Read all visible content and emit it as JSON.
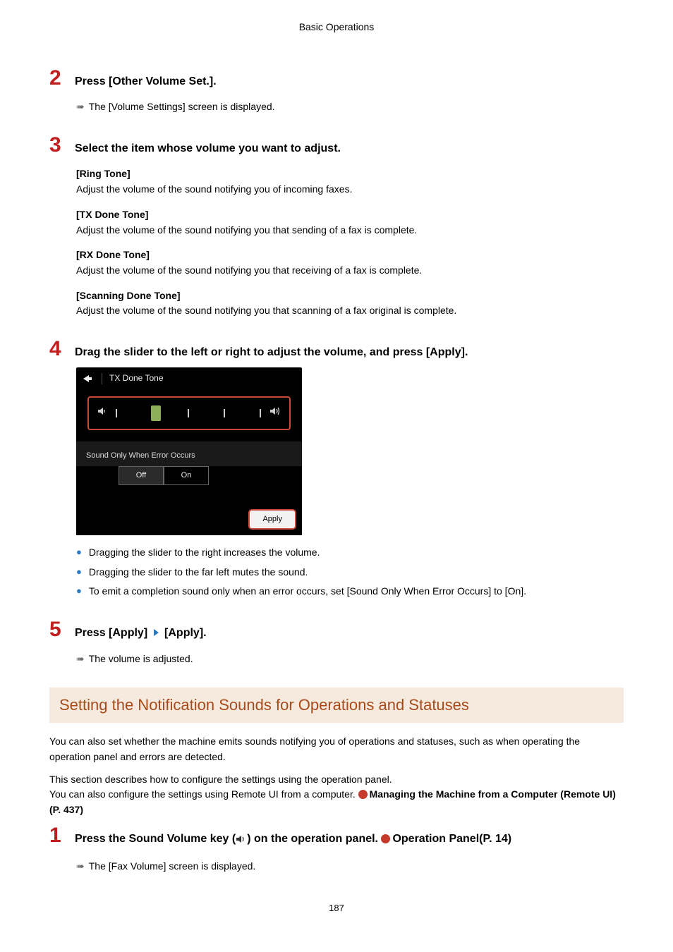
{
  "header": {
    "title": "Basic Operations"
  },
  "page_number": "187",
  "step2": {
    "num": "2",
    "title": "Press [Other Volume Set.].",
    "result": "The [Volume Settings] screen is displayed."
  },
  "step3": {
    "num": "3",
    "title": "Select the item whose volume you want to adjust.",
    "items": [
      {
        "name": "[Ring Tone]",
        "desc": "Adjust the volume of the sound notifying you of incoming faxes."
      },
      {
        "name": "[TX Done Tone]",
        "desc": "Adjust the volume of the sound notifying you that sending of a fax is complete."
      },
      {
        "name": "[RX Done Tone]",
        "desc": "Adjust the volume of the sound notifying you that receiving of a fax is complete."
      },
      {
        "name": "[Scanning Done Tone]",
        "desc": "Adjust the volume of the sound notifying you that scanning of a fax original is complete."
      }
    ]
  },
  "step4": {
    "num": "4",
    "title": "Drag the slider to the left or right to adjust the volume, and press [Apply].",
    "shot": {
      "title": "TX Done Tone",
      "section_label": "Sound Only When Error Occurs",
      "off": "Off",
      "on": "On",
      "apply": "Apply"
    },
    "bullets": [
      "Dragging the slider to the right increases the volume.",
      "Dragging the slider to the far left mutes the sound.",
      "To emit a completion sound only when an error occurs, set [Sound Only When Error Occurs] to [On]."
    ]
  },
  "step5": {
    "num": "5",
    "title_a": "Press [Apply]",
    "title_b": "[Apply].",
    "result": "The volume is adjusted."
  },
  "section": {
    "title": "Setting the Notification Sounds for Operations and Statuses",
    "para1": "You can also set whether the machine emits sounds notifying you of operations and statuses, such as when operating the operation panel and errors are detected.",
    "para2a": "This section describes how to configure the settings using the operation panel.",
    "para2b": "You can also configure the settings using Remote UI from a computer. ",
    "link1": "Managing the Machine from a Computer (Remote UI)(P. 437)"
  },
  "step1b": {
    "num": "1",
    "title_a": "Press the Sound Volume key (",
    "title_b": ") on the operation panel. ",
    "link": "Operation Panel(P. 14)",
    "result": "The [Fax Volume] screen is displayed."
  }
}
